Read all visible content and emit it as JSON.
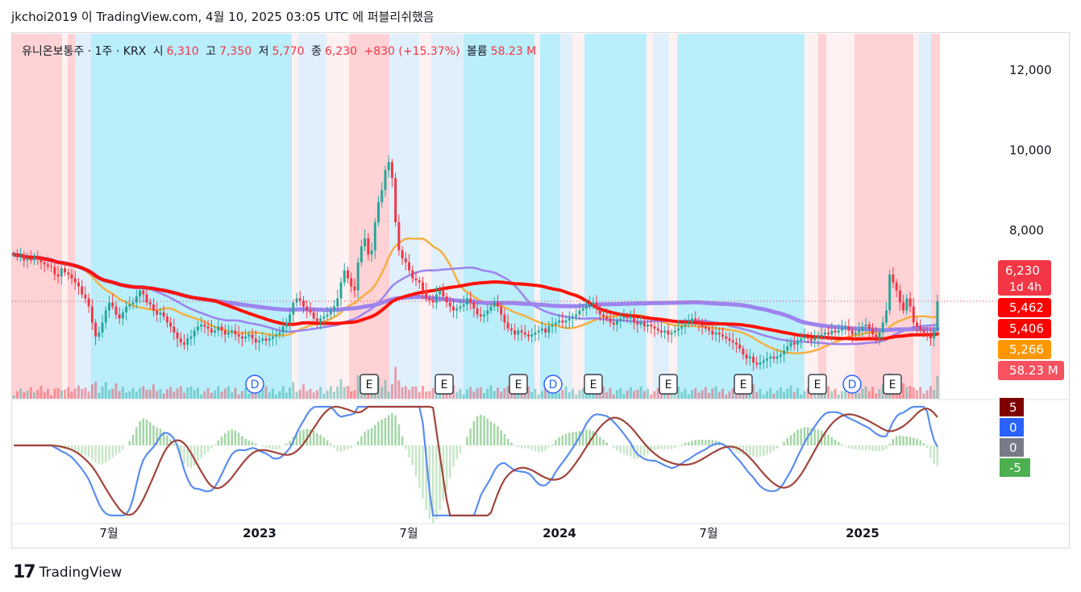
{
  "header": {
    "publish_text": "jkchoi2019 이 TradingView.com, 4월 10, 2025 03:05 UTC 에 퍼블리쉬했음"
  },
  "legend": {
    "symbol": "유니온보통주 · 1주 · KRX",
    "open_label": "시",
    "open": "6,310",
    "high_label": "고",
    "high": "7,350",
    "low_label": "저",
    "low": "5,770",
    "close_label": "종",
    "close": "6,230",
    "change": "+830 (+15.37%)",
    "volume_label": "볼륨",
    "volume": "58.23 M"
  },
  "footer": {
    "brand": "TradingView"
  },
  "colors": {
    "up": "#26a69a",
    "down": "#f23645",
    "ma_red": "#ff1100",
    "ma_purple": "#9c84ee",
    "ma_orange": "#f5b041",
    "band_red": "#ffcdd2",
    "band_pink": "#ffeef0",
    "band_cyan": "#b3ecfb",
    "band_lightblue": "#dbeefc",
    "macd": "#5b8def",
    "signal": "#a0453d"
  },
  "chart_data": [
    {
      "type": "candlestick",
      "title": "유니온보통주 · 1주 · KRX",
      "price_axis_ticks": [
        "12,000",
        "10,000",
        "8,000"
      ],
      "ylim": [
        3800,
        12900
      ],
      "time_axis_labels": [
        "7월",
        "2023",
        "7월",
        "2024",
        "7월",
        "2025"
      ],
      "last_bar": {
        "open": 6310,
        "high": 7350,
        "low": 5770,
        "close": 6230,
        "volume": "58.23M"
      },
      "price_labels": [
        {
          "text": "6,230",
          "sub": "1d 4h",
          "color": "#f23645"
        },
        {
          "text": "5,462",
          "color": "#ff0000"
        },
        {
          "text": "5,406",
          "color": "#ff0000"
        },
        {
          "text": "5,266",
          "color": "#ff9800"
        },
        {
          "text": "58.23 M",
          "color": "#f7525f"
        }
      ],
      "closes": [
        7400,
        7350,
        7380,
        7250,
        7300,
        7250,
        7320,
        7280,
        7200,
        7150,
        7100,
        7080,
        6900,
        6850,
        7050,
        6950,
        6900,
        6800,
        6700,
        6600,
        6400,
        6300,
        6100,
        5700,
        5350,
        5450,
        5700,
        6000,
        6200,
        6100,
        5900,
        5800,
        5950,
        6100,
        6150,
        6200,
        6350,
        6500,
        6400,
        6200,
        6150,
        6000,
        5900,
        5950,
        5850,
        5700,
        5600,
        5450,
        5300,
        5200,
        5150,
        5300,
        5350,
        5500,
        5600,
        5650,
        5600,
        5550,
        5450,
        5500,
        5600,
        5500,
        5400,
        5450,
        5500,
        5400,
        5350,
        5300,
        5350,
        5400,
        5300,
        5200,
        5250,
        5300,
        5250,
        5300,
        5350,
        5400,
        5450,
        5600,
        5700,
        5900,
        6200,
        6300,
        6250,
        6100,
        6000,
        5950,
        5800,
        5700,
        5800,
        5850,
        5900,
        6000,
        6100,
        6300,
        6700,
        7000,
        6800,
        6600,
        6500,
        7200,
        7600,
        7800,
        7400,
        7500,
        8200,
        8700,
        9000,
        9500,
        9700,
        9300,
        8200,
        7500,
        7300,
        7200,
        7000,
        6800,
        6750,
        6700,
        6500,
        6300,
        6250,
        6200,
        6400,
        6500,
        6350,
        6200,
        6100,
        6000,
        6050,
        6100,
        6150,
        6300,
        6200,
        6050,
        5900,
        5850,
        5900,
        6000,
        6100,
        6200,
        6100,
        5900,
        5700,
        5550,
        5500,
        5400,
        5500,
        5450,
        5400,
        5350,
        5400,
        5450,
        5500,
        5550,
        5450,
        5600,
        5650,
        5700,
        5750,
        5700,
        5750,
        5800,
        5850,
        5900,
        6000,
        6050,
        6100,
        6150,
        6200,
        6050,
        5900,
        5850,
        5800,
        5700,
        5650,
        5750,
        5800,
        5850,
        5800,
        5850,
        5700,
        5650,
        5700,
        5600,
        5650,
        5600,
        5550,
        5500,
        5450,
        5500,
        5400,
        5450,
        5500,
        5550,
        5600,
        5650,
        5700,
        5800,
        5750,
        5650,
        5600,
        5550,
        5500,
        5400,
        5450,
        5400,
        5350,
        5300,
        5250,
        5200,
        5150,
        5050,
        4900,
        4800,
        4850,
        4700,
        4650,
        4700,
        4750,
        4800,
        4850,
        4800,
        4850,
        4900,
        5000,
        5100,
        5200,
        5150,
        5250,
        5300,
        5350,
        5300,
        5250,
        5300,
        5350,
        5400,
        5450,
        5400,
        5500,
        5450,
        5500,
        5550,
        5600,
        5500,
        5400,
        5450,
        5500,
        5600,
        5650,
        5550,
        5400,
        5300,
        5450,
        5700,
        6000,
        6900,
        6700,
        6500,
        6200,
        6000,
        6300,
        6100,
        5700,
        5600,
        5500,
        5450,
        5400,
        5300,
        5500,
        6230
      ]
    },
    {
      "type": "line",
      "title": "MACD",
      "axis_values": [
        "5",
        "0",
        "0",
        "-5"
      ],
      "axis_colors": [
        "#800000",
        "#2962ff",
        "#787b86",
        "#4caf50"
      ]
    }
  ]
}
